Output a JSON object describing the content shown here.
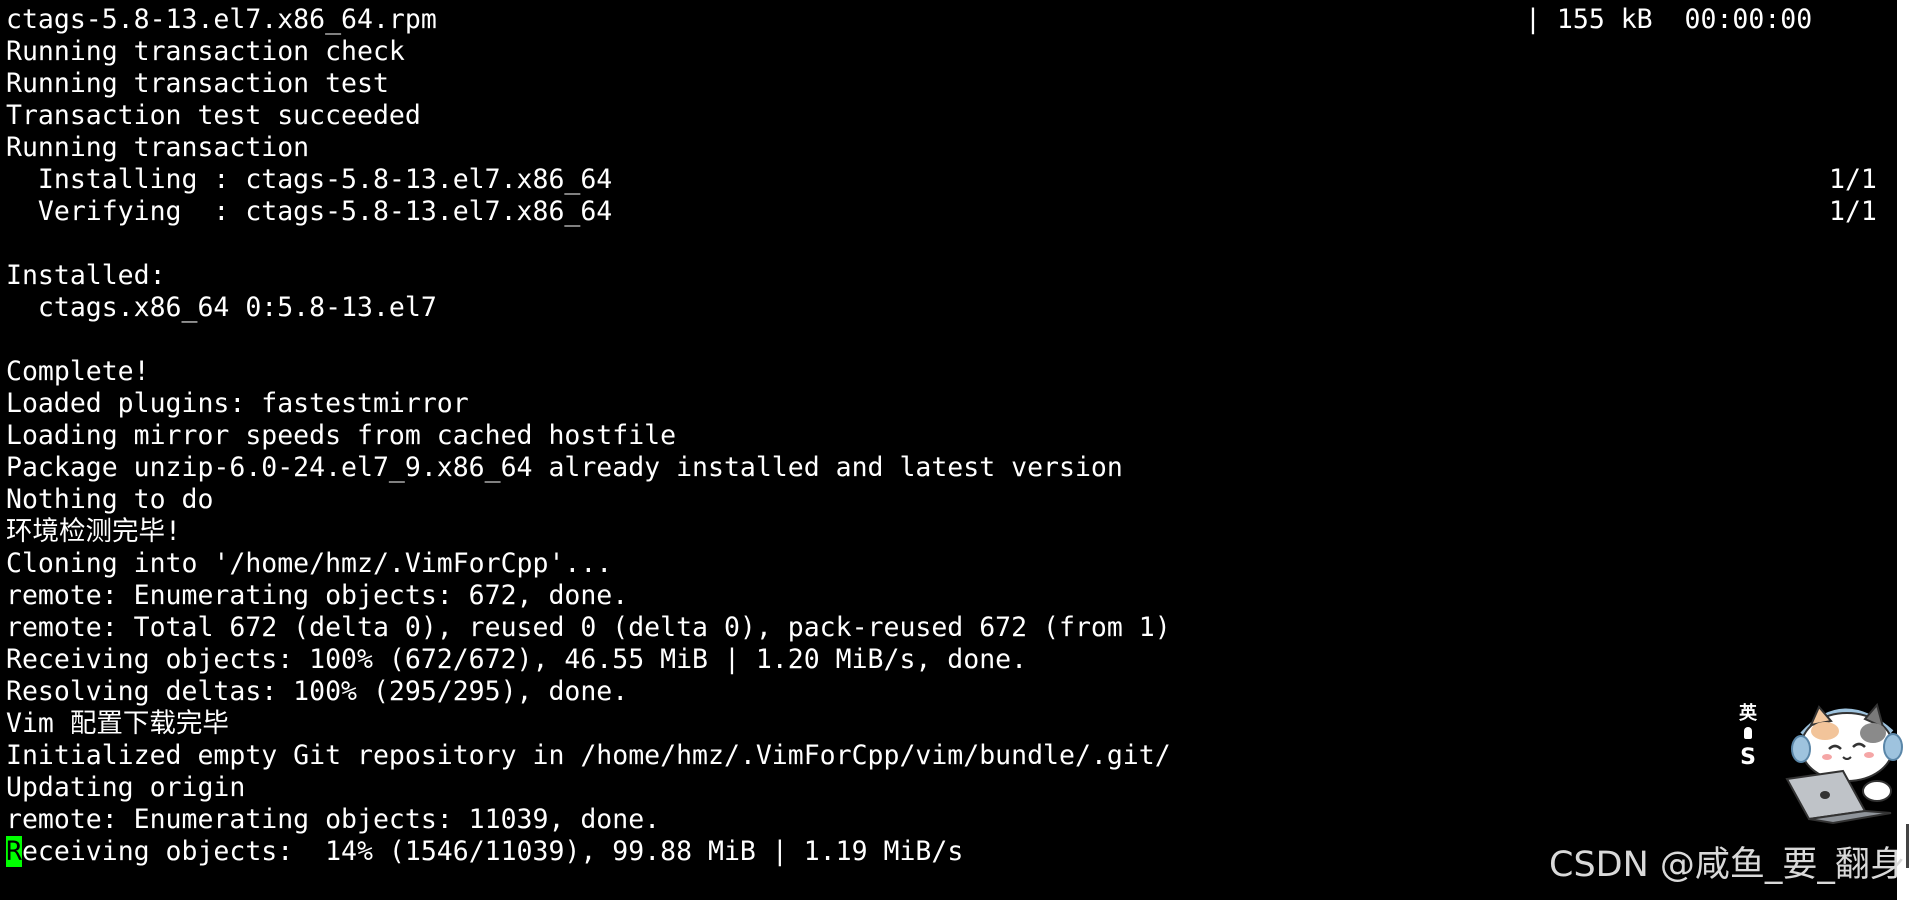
{
  "terminal": {
    "lines": [
      "ctags-5.8-13.el7.x86_64.rpm",
      "Running transaction check",
      "Running transaction test",
      "Transaction test succeeded",
      "Running transaction",
      "  Installing : ctags-5.8-13.el7.x86_64",
      "  Verifying  : ctags-5.8-13.el7.x86_64",
      "",
      "Installed:",
      "  ctags.x86_64 0:5.8-13.el7",
      "",
      "Complete!",
      "Loaded plugins: fastestmirror",
      "Loading mirror speeds from cached hostfile",
      "Package unzip-6.0-24.el7_9.x86_64 already installed and latest version",
      "Nothing to do",
      "环境检测完毕!",
      "Cloning into '/home/hmz/.VimForCpp'...",
      "remote: Enumerating objects: 672, done.",
      "remote: Total 672 (delta 0), reused 0 (delta 0), pack-reused 672 (from 1)",
      "Receiving objects: 100% (672/672), 46.55 MiB | 1.20 MiB/s, done.",
      "Resolving deltas: 100% (295/295), done.",
      "Vim 配置下载完毕",
      "Initialized empty Git repository in /home/hmz/.VimForCpp/vim/bundle/.git/",
      "Updating origin",
      "remote: Enumerating objects: 11039, done."
    ],
    "download_stats": "| 155 kB  00:00:00",
    "installing_progress": "1/1",
    "verifying_progress": "1/1",
    "cursor_char": "R",
    "current_line": "eceiving objects:  14% (1546/11039), 99.88 MiB | 1.19 MiB/s",
    "cursor_color": "#00ff00",
    "foreground_color": "#ffffff",
    "background_color": "#000000"
  },
  "ime": {
    "language": "英",
    "mode": "S",
    "mascot_icon": "cat-with-laptop-icon"
  },
  "watermark": {
    "text": "CSDN @咸鱼_要_翻身"
  }
}
